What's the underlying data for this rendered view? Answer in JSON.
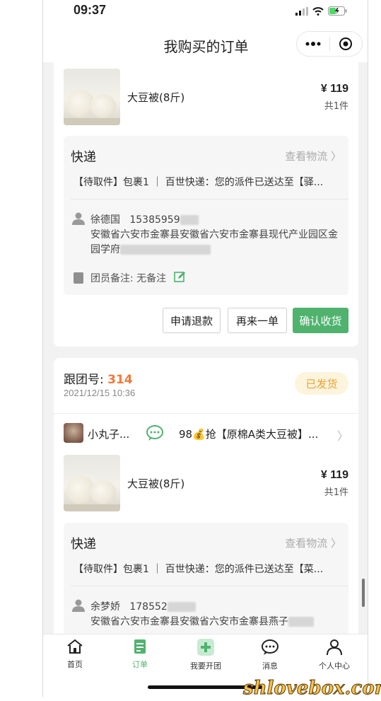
{
  "status_bar": {
    "time": "09:37"
  },
  "nav": {
    "title": "我购买的订单"
  },
  "order1": {
    "product": {
      "name": "大豆被(8斤)",
      "price": "¥ 119",
      "count": "共1件"
    },
    "shipping": {
      "title": "快递",
      "link": "查看物流 〉",
      "status": "【待取件】包裹1 ｜ 百世快递：您的派件已送达至【驿...",
      "recipient_name": "徐德国",
      "recipient_phone": "15385959",
      "address": "安徽省六安市金寨县安徽省六安市金寨县现代产业园区金园学府",
      "note": "团员备注: 无备注"
    },
    "buttons": {
      "refund": "申请退款",
      "reorder": "再来一单",
      "confirm": "确认收货"
    }
  },
  "order2": {
    "group_prefix": "跟团号: ",
    "group_number": "314",
    "date": "2021/12/15 10:36",
    "status": "已发货",
    "leader_name": "小丸子...",
    "leader_deal": "98💰抢【原棉A类大豆被】...",
    "product": {
      "name": "大豆被(8斤)",
      "price": "¥ 119",
      "count": "共1件"
    },
    "shipping": {
      "title": "快递",
      "link": "查看物流 〉",
      "status": "【待取件】包裹1 ｜ 百世快递：您的派件已送达至【菜...",
      "recipient_name": "余梦娇",
      "recipient_phone": "178552",
      "address": "安徽省六安市金寨县安徽省六安市金寨县燕子"
    }
  },
  "tabbar": {
    "items": [
      {
        "label": "首页",
        "icon": "home-icon"
      },
      {
        "label": "订单",
        "icon": "order-icon"
      },
      {
        "label": "我要开团",
        "icon": "plus-icon"
      },
      {
        "label": "消息",
        "icon": "message-icon"
      },
      {
        "label": "个人中心",
        "icon": "user-icon"
      }
    ]
  },
  "watermark": "shlovebox.com",
  "colors": {
    "accent_green": "#4fb36e",
    "group_number": "#f07a3a",
    "status_badge_text": "#e9a230",
    "status_badge_bg": "#fdf4dd"
  }
}
